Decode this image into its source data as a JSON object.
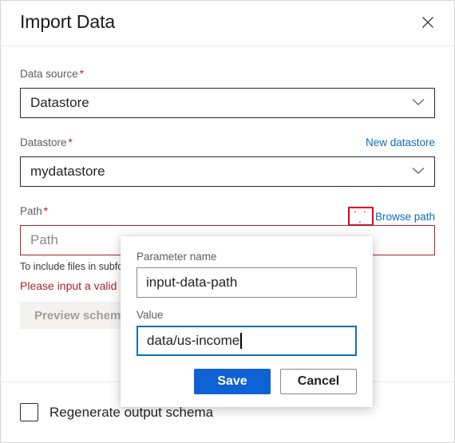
{
  "header": {
    "title": "Import Data",
    "close_icon": "close-icon"
  },
  "form": {
    "data_source": {
      "label": "Data source",
      "required_marker": "*",
      "value": "Datastore",
      "chevron_icon": "chevron-down-icon"
    },
    "datastore": {
      "label": "Datastore",
      "required_marker": "*",
      "value": "mydatastore",
      "new_link": "New datastore",
      "chevron_icon": "chevron-down-icon"
    },
    "path": {
      "label": "Path",
      "required_marker": "*",
      "placeholder": "Path",
      "value": "",
      "ellipsis_label": "· · ·",
      "browse_link": "Browse path",
      "hint": "To include files in subfolders, use '{folder}/**'.",
      "error": "Please input a valid path"
    },
    "preview_schema_label": "Preview schema"
  },
  "footer": {
    "regenerate_label": "Regenerate output schema",
    "checkbox_checked": false
  },
  "popup": {
    "parameter_name_label": "Parameter name",
    "parameter_name_value": "input-data-path",
    "value_label": "Value",
    "value_value": "data/us-income",
    "save_label": "Save",
    "cancel_label": "Cancel"
  },
  "colors": {
    "accent_blue": "#0f62d3",
    "link_blue": "#0f6cbd",
    "error_red": "#a4262c",
    "highlight_red": "#e50019",
    "text_primary": "#242424",
    "text_secondary": "#605e5c"
  }
}
